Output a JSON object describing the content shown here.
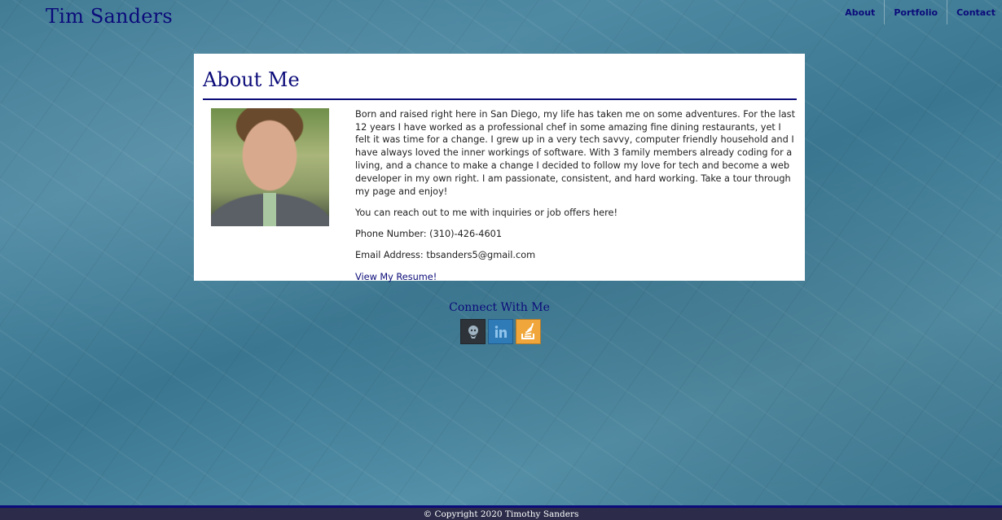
{
  "header": {
    "site_title": "Tim Sanders",
    "nav": [
      {
        "label": "About"
      },
      {
        "label": "Portfolio"
      },
      {
        "label": "Contact"
      }
    ]
  },
  "about": {
    "heading": "About Me",
    "bio": "Born and raised right here in San Diego, my life has taken me on some adventures. For the last 12 years I have worked as a professional chef in some amazing fine dining restaurants, yet I felt it was time for a change. I grew up in a very tech savvy, computer friendly household and I have always loved the inner workings of software. With 3 family members already coding for a living, and a chance to make a change I decided to follow my love for tech and become a web developer in my own right. I am passionate, consistent, and hard working. Take a tour through my page and enjoy!",
    "reach_out": "You can reach out to me with inquiries or job offers here!",
    "phone": "Phone Number: (310)-426-4601",
    "email": "Email Address: tbsanders5@gmail.com",
    "resume_link": "View My Resume!"
  },
  "connect": {
    "title": "Connect With Me",
    "icons": [
      "github-icon",
      "linkedin-icon",
      "stackoverflow-icon"
    ]
  },
  "footer": {
    "copyright": "© Copyright 2020 Timothy Sanders"
  },
  "colors": {
    "accent": "#0b0b7a",
    "footer_bg": "#2c2c4a",
    "card_bg": "#ffffff"
  }
}
